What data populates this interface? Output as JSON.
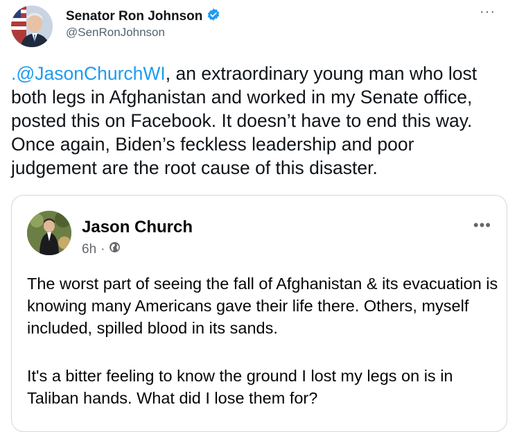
{
  "author": {
    "name": "Senator Ron Johnson",
    "handle": "@SenRonJohnson",
    "avatar_icon": "senator-portrait-avatar",
    "verified_icon": "verified-badge-icon",
    "more_icon": "more-options-icon",
    "more_label": "···"
  },
  "tweet": {
    "mention": ".@JasonChurchWI",
    "text": ", an extraordinary young man who lost both legs in Afghanistan and worked in my Senate office, posted this on Facebook. It doesn’t have to end this way. Once again, Biden’s feckless leadership and poor judgement are the root cause of this disaster."
  },
  "quoted_post": {
    "name": "Jason Church",
    "time": "6h",
    "separator": "·",
    "privacy_icon": "globe-icon",
    "more_label": "•••",
    "paragraphs": [
      "The worst part of seeing the fall of Afghanistan & its evacuation is knowing many Americans gave their life there. Others, myself included, spilled blood in its sands.",
      "It's a bitter feeling to know the ground I lost my legs on is in Taliban hands. What did I lose them for?"
    ]
  },
  "colors": {
    "link": "#1d9bf0",
    "text": "#0f1419",
    "secondary": "#536471",
    "border": "#cfd9de"
  }
}
